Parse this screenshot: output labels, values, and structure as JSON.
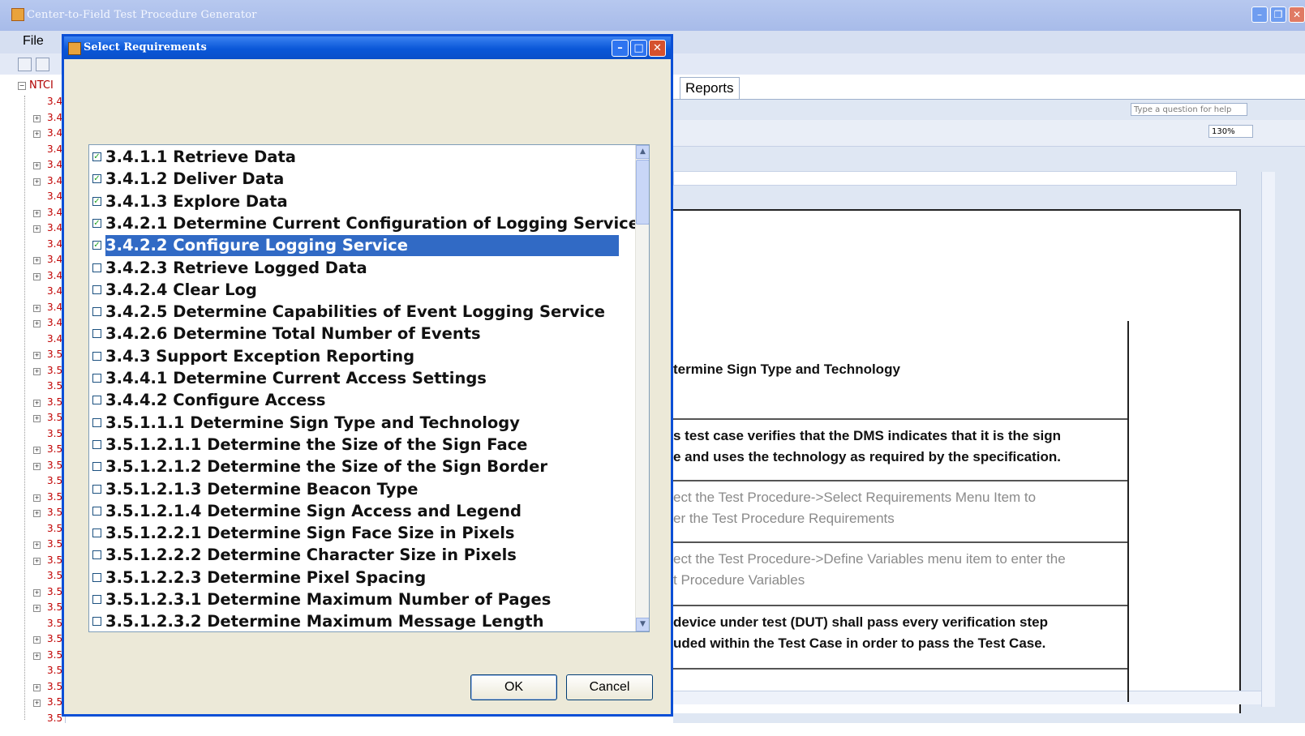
{
  "main_window": {
    "title": "Center-to-Field Test Procedure Generator",
    "menu_file": "File"
  },
  "tree": {
    "root_label": "NTCI",
    "items": [
      "3.4",
      "3.4",
      "3.4",
      "3.4",
      "3.4",
      "3.4",
      "3.4",
      "3.4",
      "3.4",
      "3.4",
      "3.4",
      "3.4",
      "3.4",
      "3.4",
      "3.4",
      "3.4",
      "3.5",
      "3.5",
      "3.5",
      "3.5",
      "3.5",
      "3.5",
      "3.5",
      "3.5",
      "3.5",
      "3.5",
      "3.5",
      "3.5",
      "3.5",
      "3.5",
      "3.5",
      "3.5",
      "3.5",
      "3.5",
      "3.5",
      "3.5",
      "3.5",
      "3.5",
      "3.5",
      "3.5"
    ]
  },
  "word": {
    "tab_reports": "Reports",
    "help_placeholder": "Type a question for help",
    "zoom": "130%",
    "table_rows": [
      {
        "lines": [
          "termine Sign Type and Technology"
        ],
        "style": "bold"
      },
      {
        "lines": [
          "s test case verifies that the DMS indicates that it is the sign",
          "e and uses the technology as required by the specification."
        ],
        "style": "bold"
      },
      {
        "lines": [
          "ect the Test Procedure->Select Requirements Menu Item to",
          "er the Test Procedure Requirements"
        ],
        "style": "gray"
      },
      {
        "lines": [
          "ect the Test Procedure->Define Variables menu item to enter the",
          "t Procedure Variables"
        ],
        "style": "gray"
      },
      {
        "lines": [
          "device under test (DUT) shall pass every verification step",
          "uded within the Test Case in order to pass the Test Case."
        ],
        "style": "bold"
      }
    ]
  },
  "dialog": {
    "title": "Select Requirements",
    "requirements": [
      {
        "label": "3.4.1.1 Retrieve Data",
        "checked": true,
        "selected": false
      },
      {
        "label": "3.4.1.2 Deliver Data",
        "checked": true,
        "selected": false
      },
      {
        "label": "3.4.1.3 Explore Data",
        "checked": true,
        "selected": false
      },
      {
        "label": "3.4.2.1 Determine Current Configuration of Logging Service",
        "checked": true,
        "selected": false
      },
      {
        "label": "3.4.2.2 Configure Logging Service",
        "checked": true,
        "selected": true
      },
      {
        "label": "3.4.2.3 Retrieve Logged Data",
        "checked": false,
        "selected": false
      },
      {
        "label": "3.4.2.4 Clear Log",
        "checked": false,
        "selected": false
      },
      {
        "label": "3.4.2.5 Determine Capabilities of Event Logging Service",
        "checked": false,
        "selected": false
      },
      {
        "label": "3.4.2.6 Determine Total Number of Events",
        "checked": false,
        "selected": false
      },
      {
        "label": "3.4.3 Support Exception Reporting",
        "checked": false,
        "selected": false
      },
      {
        "label": "3.4.4.1 Determine Current Access Settings",
        "checked": false,
        "selected": false
      },
      {
        "label": "3.4.4.2 Configure Access",
        "checked": false,
        "selected": false
      },
      {
        "label": "3.5.1.1.1 Determine Sign Type and Technology",
        "checked": false,
        "selected": false
      },
      {
        "label": "3.5.1.2.1.1 Determine the Size of the Sign Face",
        "checked": false,
        "selected": false
      },
      {
        "label": "3.5.1.2.1.2 Determine the Size of the Sign Border",
        "checked": false,
        "selected": false
      },
      {
        "label": "3.5.1.2.1.3 Determine Beacon Type",
        "checked": false,
        "selected": false
      },
      {
        "label": "3.5.1.2.1.4 Determine Sign Access and Legend",
        "checked": false,
        "selected": false
      },
      {
        "label": "3.5.1.2.2.1 Determine Sign Face Size in Pixels",
        "checked": false,
        "selected": false
      },
      {
        "label": "3.5.1.2.2.2 Determine Character Size in Pixels",
        "checked": false,
        "selected": false
      },
      {
        "label": "3.5.1.2.2.3 Determine Pixel Spacing",
        "checked": false,
        "selected": false
      },
      {
        "label": "3.5.1.2.3.1 Determine Maximum Number of Pages",
        "checked": false,
        "selected": false
      },
      {
        "label": "3.5.1.2.3.2 Determine Maximum Message Length",
        "checked": false,
        "selected": false
      }
    ],
    "ok_label": "OK",
    "cancel_label": "Cancel"
  },
  "colors": {
    "dialog_title": "#0a57d8",
    "selection": "#316ac5",
    "tree_text": "#c00000"
  }
}
